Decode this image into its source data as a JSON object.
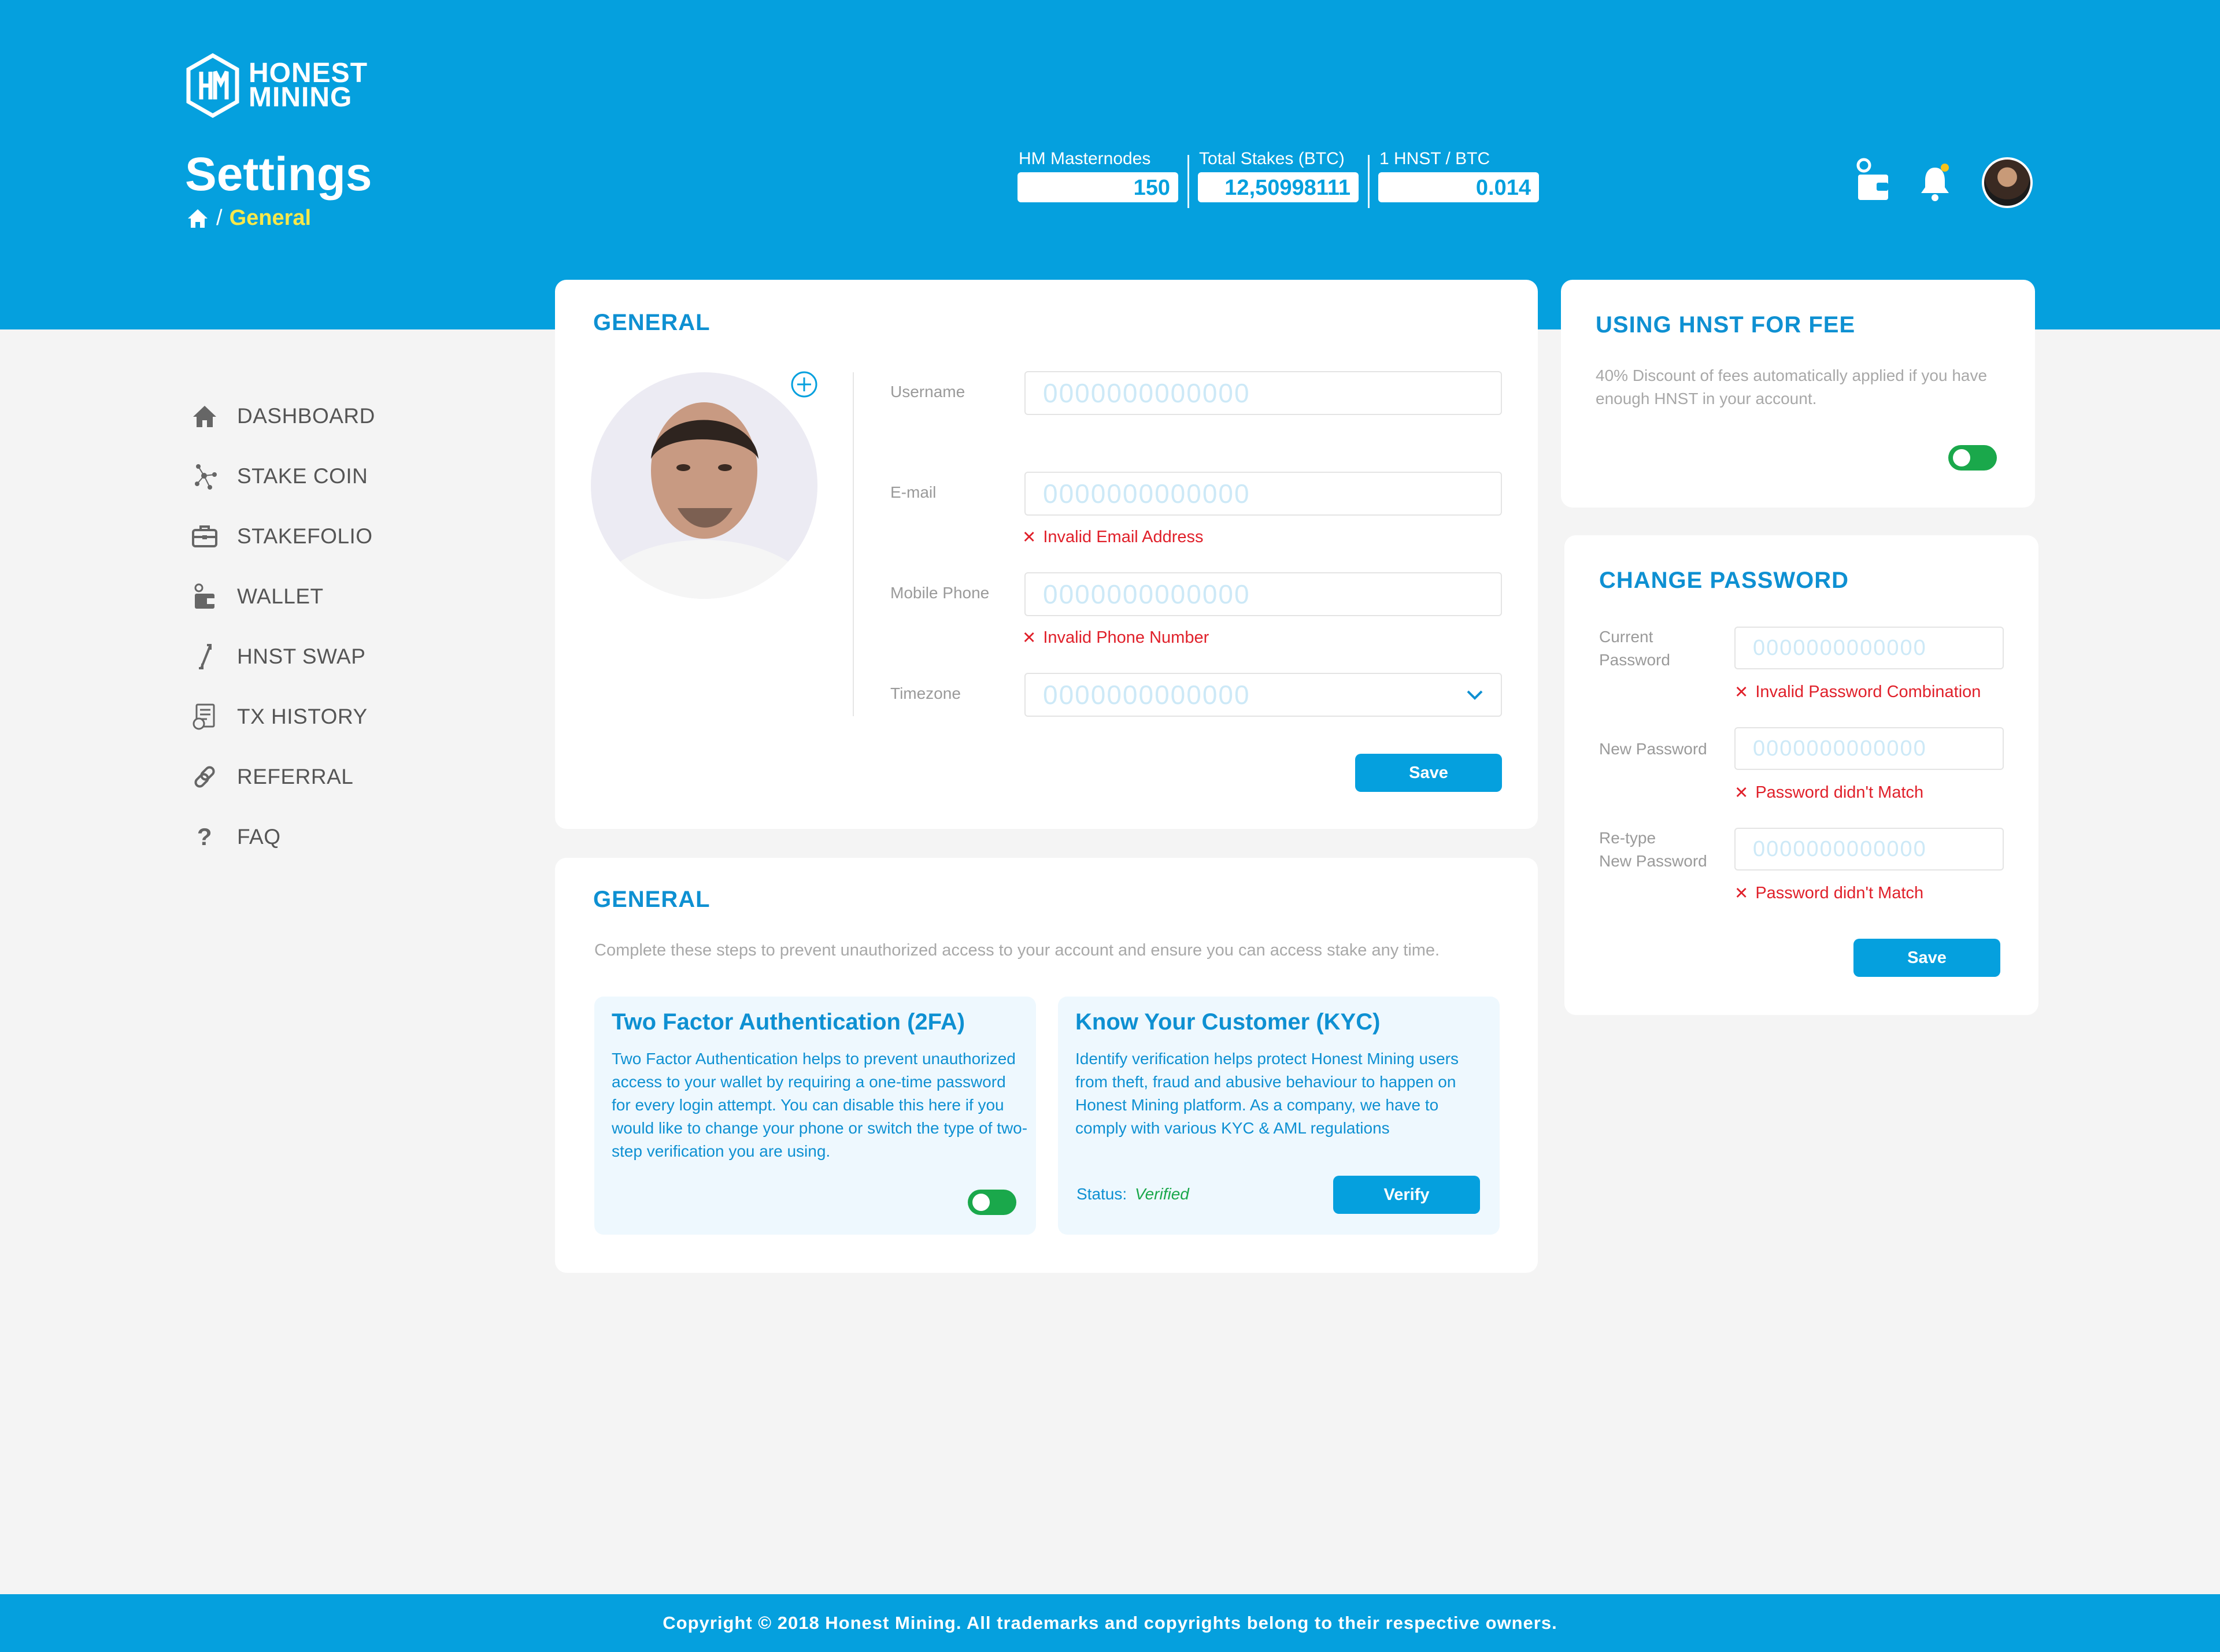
{
  "brand": {
    "line1": "HONEST",
    "line2": "MINING"
  },
  "page": {
    "title": "Settings",
    "breadcrumb_sep": "/",
    "breadcrumb_current": "General"
  },
  "stats": [
    {
      "label": "HM Masternodes",
      "value": "150"
    },
    {
      "label": "Total Stakes (BTC)",
      "value": "12,50998111"
    },
    {
      "label": "1 HNST / BTC",
      "value": "0.014"
    }
  ],
  "header_icons": [
    "wallet-icon",
    "bell-icon",
    "avatar"
  ],
  "nav": [
    {
      "label": "DASHBOARD",
      "icon": "home-icon"
    },
    {
      "label": "STAKE COIN",
      "icon": "stake-icon"
    },
    {
      "label": "STAKEFOLIO",
      "icon": "briefcase-icon"
    },
    {
      "label": "WALLET",
      "icon": "wallet-icon"
    },
    {
      "label": "HNST SWAP",
      "icon": "swap-icon"
    },
    {
      "label": "TX HISTORY",
      "icon": "history-icon"
    },
    {
      "label": "REFERRAL",
      "icon": "link-icon"
    },
    {
      "label": "FAQ",
      "icon": "question-icon"
    }
  ],
  "general": {
    "title": "GENERAL",
    "fields": {
      "username": {
        "label": "Username",
        "placeholder": "0000000000000"
      },
      "email": {
        "label": "E-mail",
        "placeholder": "0000000000000",
        "error": "Invalid Email Address"
      },
      "phone": {
        "label": "Mobile Phone",
        "placeholder": "0000000000000",
        "error": "Invalid Phone Number"
      },
      "timezone": {
        "label": "Timezone",
        "value": "0000000000000"
      }
    },
    "save_label": "Save"
  },
  "security": {
    "title": "GENERAL",
    "description": "Complete these steps to prevent unauthorized access to your account and ensure you can access stake any time.",
    "twofa": {
      "title": "Two Factor Authentication (2FA)",
      "text": "Two Factor Authentication helps to prevent unauthorized access to your wallet by requiring a one-time password for every login attempt. You can disable this here if you would like to change your phone or switch the type of two-step verification you are using.",
      "enabled": true
    },
    "kyc": {
      "title": "Know Your Customer (KYC)",
      "text": "Identify verification helps protect Honest Mining users from theft, fraud and abusive behaviour to happen on Honest Mining platform. As a company, we have to comply with various KYC & AML regulations",
      "status_label": "Status:",
      "status_value": "Verified",
      "verify_label": "Verify"
    }
  },
  "fee": {
    "title": "USING HNST FOR FEE",
    "text": "40% Discount of fees automatically applied if you have enough HNST in your account.",
    "enabled": true
  },
  "password": {
    "title": "CHANGE PASSWORD",
    "current": {
      "label_line1": "Current",
      "label_line2": "Password",
      "placeholder": "0000000000000",
      "error": "Invalid Password Combination"
    },
    "new": {
      "label": "New Password",
      "placeholder": "0000000000000",
      "error": "Password didn't Match"
    },
    "retype": {
      "label_line1": "Re-type",
      "label_line2": "New Password",
      "placeholder": "0000000000000",
      "error": "Password didn't Match"
    },
    "save_label": "Save"
  },
  "footer": {
    "text": "Copyright © 2018 Honest Mining. All trademarks and copyrights belong to their respective owners."
  },
  "colors": {
    "primary": "#05a0de",
    "title_blue": "#0e90d2",
    "error": "#e0202a",
    "toggle_on": "#1aa84b",
    "crumb_active": "#f7e84a"
  }
}
